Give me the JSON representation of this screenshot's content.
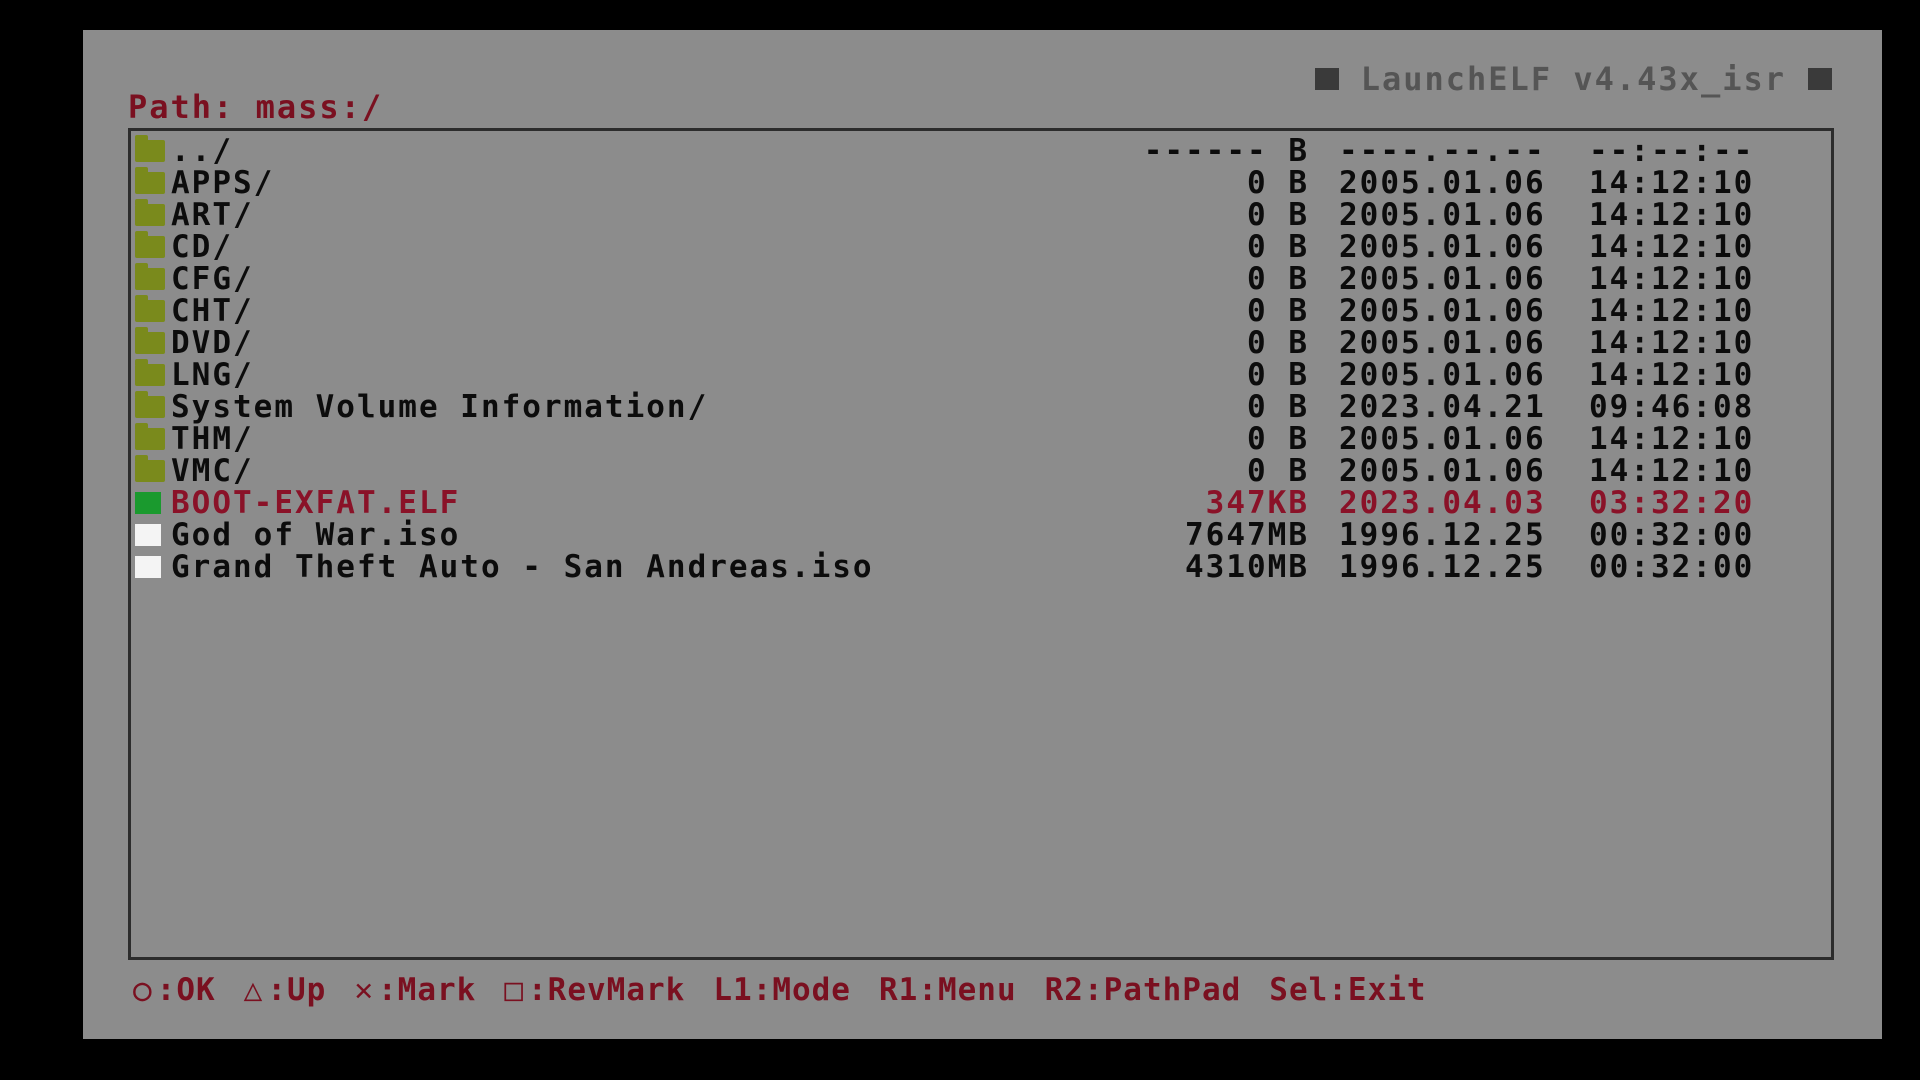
{
  "header": {
    "app_title": "LaunchELF v4.43x_isr",
    "path_label": "Path: mass:/"
  },
  "colors": {
    "screen_bg": "#8c8c8c",
    "selected_text": "#8a1228",
    "folder_icon": "#7a8a1c",
    "elf_icon": "#1a9a2e",
    "file_icon": "#f4f4f4"
  },
  "files": [
    {
      "name": "../",
      "size": "------ B",
      "date": "----.--.--",
      "time": "--:--:--",
      "icon": "folder-icon",
      "selected": false
    },
    {
      "name": "APPS/",
      "size": "0 B",
      "date": "2005.01.06",
      "time": "14:12:10",
      "icon": "folder-icon",
      "selected": false
    },
    {
      "name": "ART/",
      "size": "0 B",
      "date": "2005.01.06",
      "time": "14:12:10",
      "icon": "folder-icon",
      "selected": false
    },
    {
      "name": "CD/",
      "size": "0 B",
      "date": "2005.01.06",
      "time": "14:12:10",
      "icon": "folder-icon",
      "selected": false
    },
    {
      "name": "CFG/",
      "size": "0 B",
      "date": "2005.01.06",
      "time": "14:12:10",
      "icon": "folder-icon",
      "selected": false
    },
    {
      "name": "CHT/",
      "size": "0 B",
      "date": "2005.01.06",
      "time": "14:12:10",
      "icon": "folder-icon",
      "selected": false
    },
    {
      "name": "DVD/",
      "size": "0 B",
      "date": "2005.01.06",
      "time": "14:12:10",
      "icon": "folder-icon",
      "selected": false
    },
    {
      "name": "LNG/",
      "size": "0 B",
      "date": "2005.01.06",
      "time": "14:12:10",
      "icon": "folder-icon",
      "selected": false
    },
    {
      "name": "System Volume Information/",
      "size": "0 B",
      "date": "2023.04.21",
      "time": "09:46:08",
      "icon": "folder-icon",
      "selected": false
    },
    {
      "name": "THM/",
      "size": "0 B",
      "date": "2005.01.06",
      "time": "14:12:10",
      "icon": "folder-icon",
      "selected": false
    },
    {
      "name": "VMC/",
      "size": "0 B",
      "date": "2005.01.06",
      "time": "14:12:10",
      "icon": "folder-icon",
      "selected": false
    },
    {
      "name": "BOOT-EXFAT.ELF",
      "size": "347KB",
      "date": "2023.04.03",
      "time": "03:32:20",
      "icon": "elf-file-icon",
      "selected": true
    },
    {
      "name": "God of War.iso",
      "size": "7647MB",
      "date": "1996.12.25",
      "time": "00:32:00",
      "icon": "file-icon",
      "selected": false
    },
    {
      "name": "Grand Theft Auto - San Andreas.iso",
      "size": "4310MB",
      "date": "1996.12.25",
      "time": "00:32:00",
      "icon": "file-icon",
      "selected": false
    }
  ],
  "hints": [
    {
      "glyph": "○",
      "glyph_name": "circle-button-icon",
      "label": ":OK"
    },
    {
      "glyph": "△",
      "glyph_name": "triangle-button-icon",
      "label": ":Up"
    },
    {
      "glyph": "✕",
      "glyph_name": "cross-button-icon",
      "label": ":Mark"
    },
    {
      "glyph": "□",
      "glyph_name": "square-button-icon",
      "label": ":RevMark"
    },
    {
      "glyph": "",
      "glyph_name": "",
      "label": "L1:Mode"
    },
    {
      "glyph": "",
      "glyph_name": "",
      "label": "R1:Menu"
    },
    {
      "glyph": "",
      "glyph_name": "",
      "label": "R2:PathPad"
    },
    {
      "glyph": "",
      "glyph_name": "",
      "label": "Sel:Exit"
    }
  ]
}
